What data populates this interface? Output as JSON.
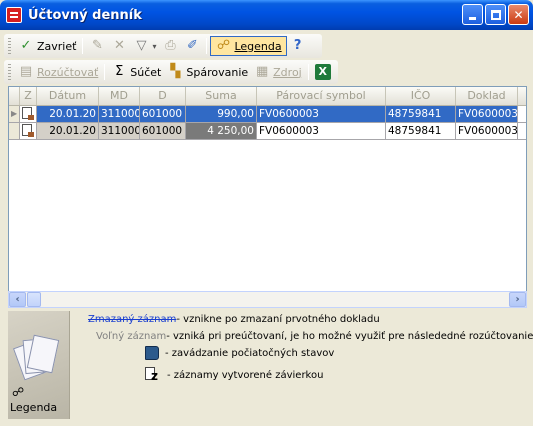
{
  "window": {
    "title": "Účtovný denník"
  },
  "toolbar1": {
    "close_label": "Zavrieť",
    "legend_label": "Legenda"
  },
  "toolbar2": {
    "rozuctovat_label": "Rozúčtovať",
    "sucet_label": "Súčet",
    "parovanie_label": "Spárovanie",
    "zdroj_label": "Zdroj"
  },
  "grid": {
    "columns": [
      "Z",
      "Dátum",
      "MD",
      "D",
      "Suma",
      "Párovací symbol",
      "IČO",
      "Doklad"
    ],
    "rows": [
      {
        "datum": "20.01.20",
        "md": "311000",
        "d": "601000",
        "suma": "990,00",
        "parovaci": "FV0600003",
        "ico": "48759841",
        "doklad": "FV0600003",
        "selected": true
      },
      {
        "datum": "20.01.20",
        "md": "311000",
        "d": "601000",
        "suma": "4 250,00",
        "parovaci": "FV0600003",
        "ico": "48759841",
        "doklad": "FV0600003",
        "selected": false
      }
    ]
  },
  "legend": {
    "side_label": "Legenda",
    "deleted_term": "Zmazaný záznam",
    "deleted_desc": " - vznikne po zmazaní prvotného dokladu",
    "free_term": "Voľný záznam",
    "free_desc": " - vzniká pri preúčtovaní, je ho možné využiť pre následedné rozúčtovanie",
    "initial_desc": "- zavádzanie počiatočných stavov",
    "closing_desc": "- záznamy vytvorené závierkou"
  },
  "icons": [
    "window-icon",
    "checkmark-icon",
    "edit-icon",
    "delete-icon",
    "filter-icon",
    "print-icon",
    "pencil-icon",
    "legend-icon",
    "help-icon",
    "split-icon",
    "sum-icon",
    "pairing-icon",
    "source-icon",
    "excel-icon"
  ]
}
